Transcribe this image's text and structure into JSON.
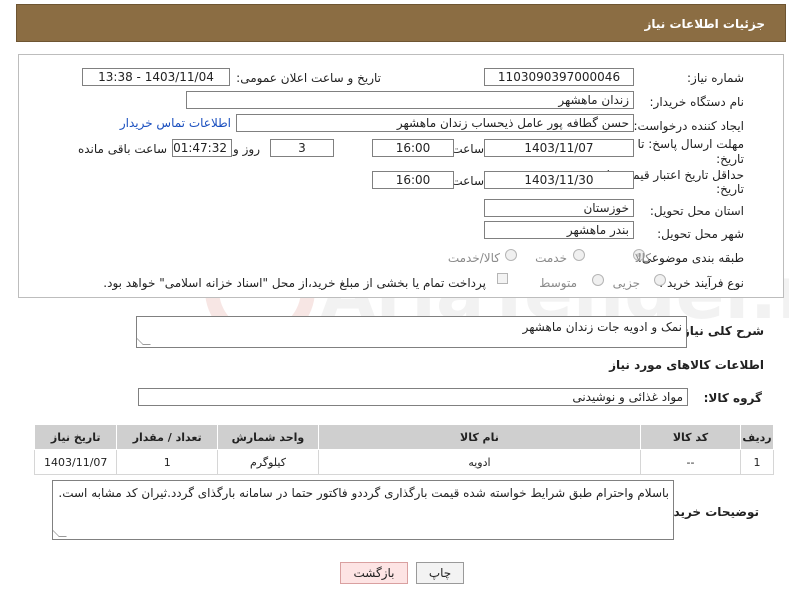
{
  "header": {
    "title": "جزئیات اطلاعات نیاز"
  },
  "form": {
    "need_number": {
      "label": "شماره نیاز:",
      "value": "1103090397000046"
    },
    "announce_datetime": {
      "label": "تاریخ و ساعت اعلان عمومی:",
      "value": "1403/11/04 - 13:38"
    },
    "buyer_org": {
      "label": "نام دستگاه خریدار:",
      "value": "زندان ماهشهر"
    },
    "requester": {
      "label": "ایجاد کننده درخواست:",
      "value": "حسن گطافه پور عامل ذیحساب زندان ماهشهر",
      "contact_link": "اطلاعات تماس خریدار"
    },
    "reply_deadline": {
      "label_line1": "مهلت ارسال پاسخ: تا",
      "label_line2": "تاریخ:",
      "date": "1403/11/07",
      "time_label": "ساعت",
      "time": "16:00",
      "days": "3",
      "days_label": "روز و",
      "remaining": "01:47:32",
      "remaining_label": "ساعت باقی مانده"
    },
    "price_validity": {
      "label_line1": "حداقل تاریخ اعتبار قیمت: تا",
      "label_line2": "تاریخ:",
      "date": "1403/11/30",
      "time_label": "ساعت",
      "time": "16:00"
    },
    "delivery_province": {
      "label": "استان محل تحویل:",
      "value": "خوزستان"
    },
    "delivery_city": {
      "label": "شهر محل تحویل:",
      "value": "بندر ماهشهر"
    },
    "category": {
      "label": "طبقه بندی موضوعی:",
      "options": [
        "کالا",
        "خدمت",
        "کالا/خدمت"
      ],
      "selected": "کالا"
    },
    "purchase_type": {
      "label": "نوع فرآیند خرید :",
      "options": [
        "جزیی",
        "متوسط"
      ],
      "payment_note": "پرداخت تمام یا بخشی از مبلغ خرید،از محل \"اسناد خزانه اسلامی\" خواهد بود."
    }
  },
  "description": {
    "label": "شرح کلی نیاز:",
    "value": "نمک و ادویه جات زندان ماهشهر"
  },
  "goods_section": {
    "title": "اطلاعات کالاهای مورد نیاز"
  },
  "goods_group": {
    "label": "گروه کالا:",
    "value": "مواد غذائی و نوشیدنی"
  },
  "table": {
    "headers": [
      "ردیف",
      "کد کالا",
      "نام کالا",
      "واحد شمارش",
      "تعداد / مقدار",
      "تاریخ نیاز"
    ],
    "rows": [
      [
        "1",
        "--",
        "ادویه",
        "کیلوگرم",
        "1",
        "1403/11/07"
      ]
    ]
  },
  "buyer_notes": {
    "label": "توضیحات خریدار:",
    "value": "باسلام واحترام طبق شرایط خواسته شده قیمت بارگذاری گرددو فاکتور حتما در سامانه بارگذای گردد.ثیران کد مشابه است."
  },
  "buttons": {
    "print": "چاپ",
    "back": "بازگشت"
  },
  "watermark": {
    "text": "AriaTender.net"
  }
}
